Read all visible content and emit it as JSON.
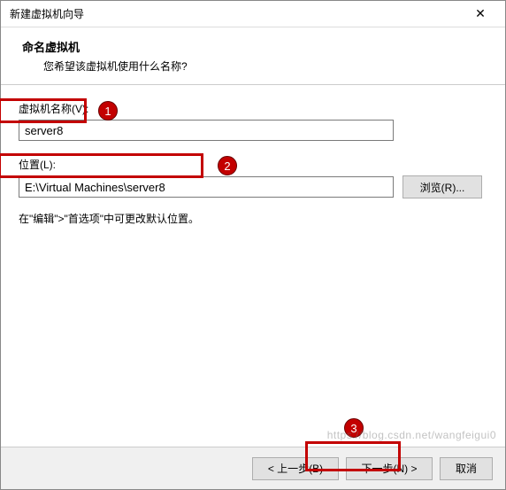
{
  "window": {
    "title": "新建虚拟机向导"
  },
  "header": {
    "title": "命名虚拟机",
    "subtitle": "您希望该虚拟机使用什么名称?"
  },
  "fields": {
    "name_label": "虚拟机名称(V):",
    "name_value": "server8",
    "location_label": "位置(L):",
    "location_value": "E:\\Virtual Machines\\server8",
    "browse_label": "浏览(R)..."
  },
  "hint": "在\"编辑\">\"首选项\"中可更改默认位置。",
  "footer": {
    "back": "< 上一步(B)",
    "next": "下一步(N) >",
    "cancel": "取消"
  },
  "annotations": {
    "badge1": "1",
    "badge2": "2",
    "badge3": "3"
  },
  "watermark": "https://blog.csdn.net/wangfeigui0"
}
